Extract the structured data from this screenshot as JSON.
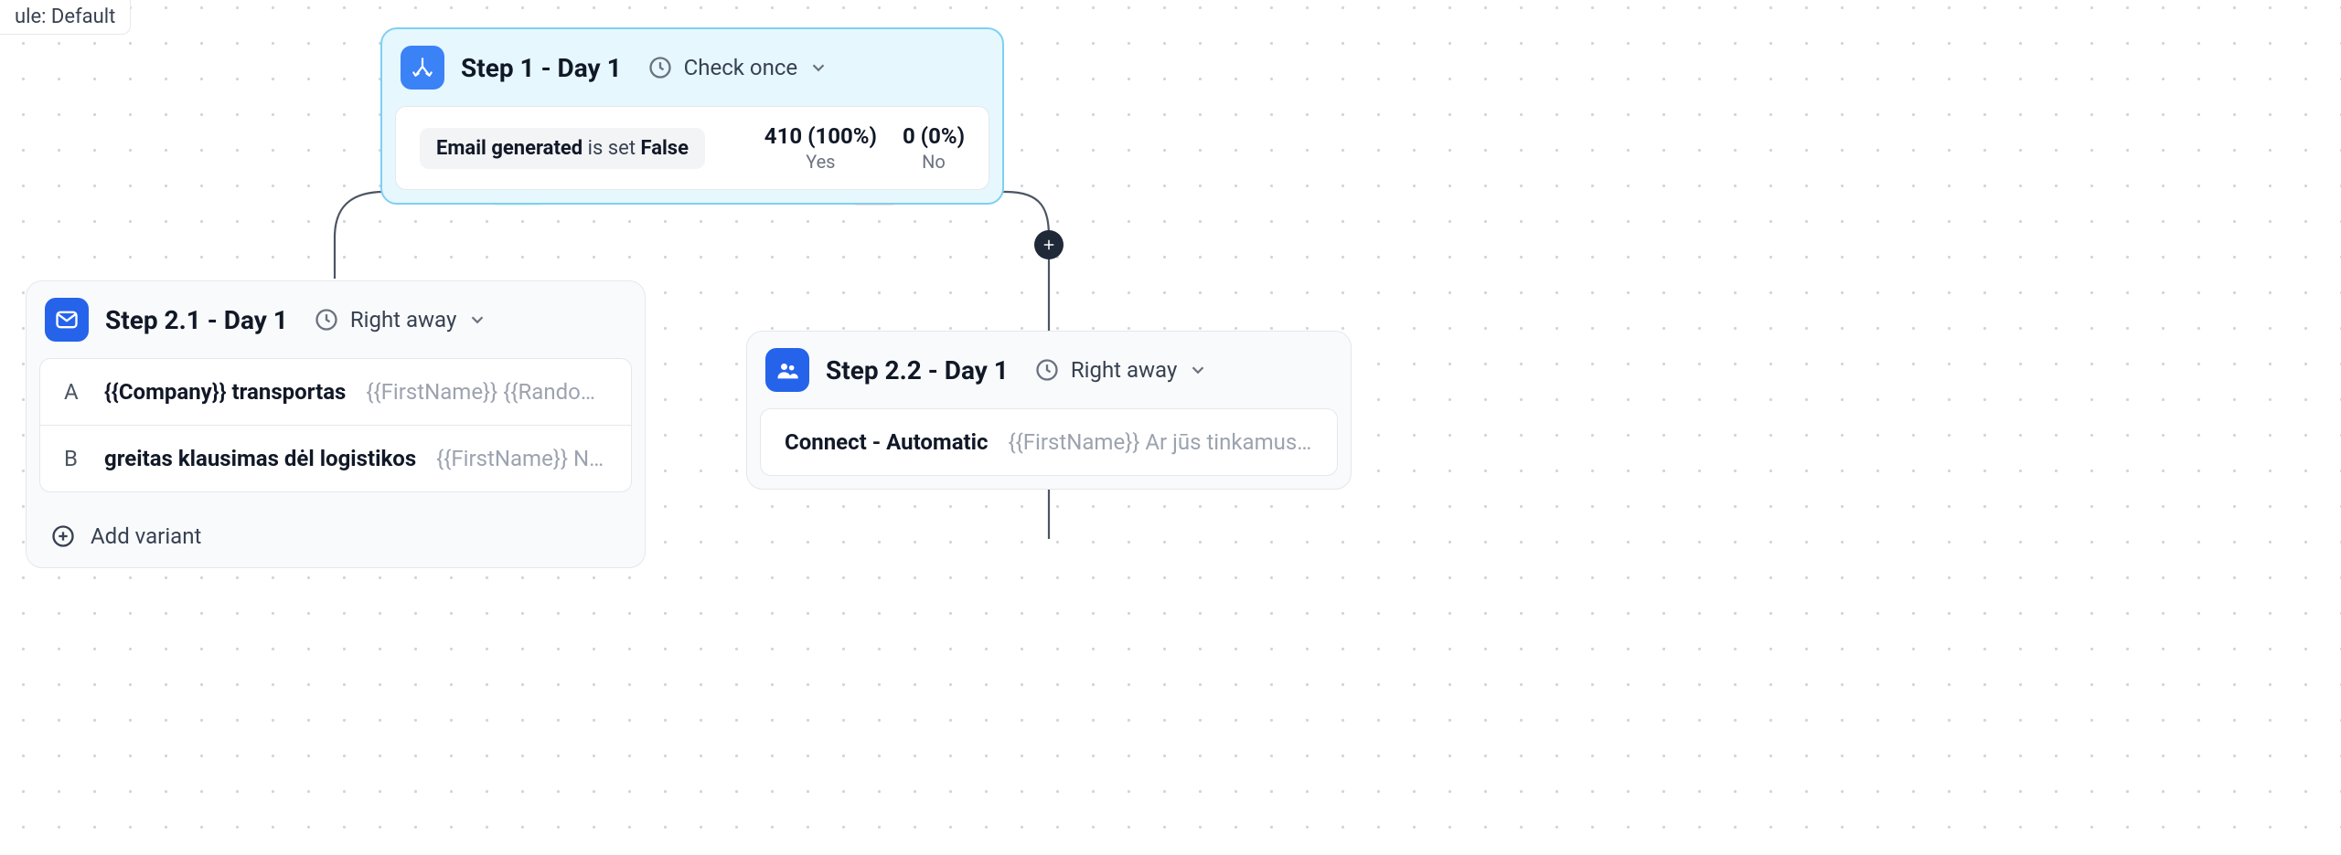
{
  "rule_chip": "ule: Default",
  "branches": {
    "yes": "Yes",
    "no": "No"
  },
  "step1": {
    "title": "Step 1 - Day 1",
    "timing": "Check once",
    "condition": {
      "field": "Email generated",
      "op": "is set",
      "value": "False"
    },
    "stats": {
      "yes": {
        "value": "410 (100%)",
        "label": "Yes"
      },
      "no": {
        "value": "0 (0%)",
        "label": "No"
      }
    }
  },
  "step21": {
    "title": "Step 2.1 - Day 1",
    "timing": "Right away",
    "variants": [
      {
        "key": "A",
        "subject": "{{Company}} transportas",
        "preview": "{{FirstName}} {{Random | 'rašau' | 'kreipiuo..."
      },
      {
        "key": "B",
        "subject": "greitas klausimas dėl logistikos",
        "preview": "{{FirstName}} Norėjau sužinoti ar {{C..."
      }
    ],
    "add_variant": "Add variant"
  },
  "step22": {
    "title": "Step 2.2 - Day 1",
    "timing": "Right away",
    "item": {
      "subject": "Connect - Automatic",
      "preview": "{{FirstName}}  Ar jūs tinkamus žmogus aptarti {{C..."
    }
  }
}
